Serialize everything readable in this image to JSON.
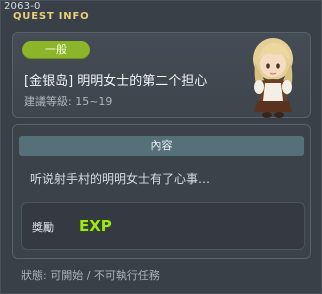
{
  "window": {
    "id_text": "2063-0",
    "title": "QUEST INFO"
  },
  "quest": {
    "category": "一般",
    "title": "[金银岛] 明明女士的第二个担心",
    "recommended_level": "建議等級: 15~19"
  },
  "npc": {
    "icon": "npc-portrait-blonde-girl"
  },
  "content": {
    "header": "內容",
    "description": "听说射手村的明明女士有了心事…"
  },
  "reward": {
    "label": "獎勵",
    "items": [
      {
        "icon": "exp-icon",
        "text": "EXP"
      }
    ]
  },
  "status": {
    "text": "狀態: 可開始 / 不可執行任務"
  },
  "colors": {
    "title_gold": "#e8d07a",
    "badge_green": "#8cb529",
    "exp_green": "#9ee61f",
    "section_teal": "#56707a"
  }
}
